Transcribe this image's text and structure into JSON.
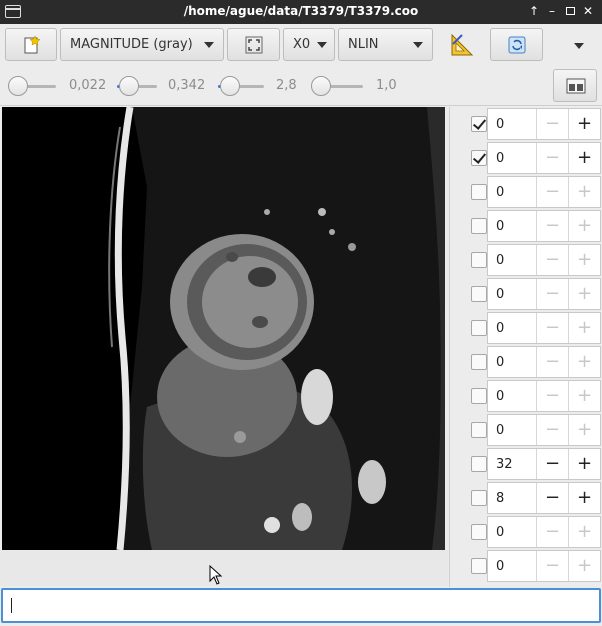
{
  "window": {
    "title": "/home/ague/data/T3379/T3379.coo",
    "controls": [
      "up-arrow-icon",
      "minimize-icon",
      "maximize-icon",
      "close-icon"
    ]
  },
  "toolbar1": {
    "new_icon": "new-document-icon",
    "colormap": "MAGNITUDE (gray)",
    "fit_icon": "fit-to-view-icon",
    "axis": "X0",
    "scale": "NLIN",
    "measure_icon": "measure-triangle-icon",
    "refresh_icon": "refresh-icon",
    "more_icon": "chevron-down-icon"
  },
  "toolbar2": {
    "sliders": [
      {
        "name": "slider-min",
        "value": "0,022",
        "level": 0.0
      },
      {
        "name": "slider-max",
        "value": "0,342",
        "level": 0.15
      },
      {
        "name": "slider-gamma",
        "value": "2,8",
        "level": 0.15
      },
      {
        "name": "slider-alpha",
        "value": "1,0",
        "level": 0.0
      }
    ],
    "layout_icon": "layout-toggle-icon"
  },
  "dimensions": [
    {
      "checked": true,
      "value": "0",
      "minus": false,
      "plus": true
    },
    {
      "checked": true,
      "value": "0",
      "minus": false,
      "plus": true
    },
    {
      "checked": false,
      "value": "0",
      "minus": false,
      "plus": false
    },
    {
      "checked": false,
      "value": "0",
      "minus": false,
      "plus": false
    },
    {
      "checked": false,
      "value": "0",
      "minus": false,
      "plus": false
    },
    {
      "checked": false,
      "value": "0",
      "minus": false,
      "plus": false
    },
    {
      "checked": false,
      "value": "0",
      "minus": false,
      "plus": false
    },
    {
      "checked": false,
      "value": "0",
      "minus": false,
      "plus": false
    },
    {
      "checked": false,
      "value": "0",
      "minus": false,
      "plus": false
    },
    {
      "checked": false,
      "value": "0",
      "minus": false,
      "plus": false
    },
    {
      "checked": false,
      "value": "32",
      "minus": true,
      "plus": true
    },
    {
      "checked": false,
      "value": "8",
      "minus": true,
      "plus": true
    },
    {
      "checked": false,
      "value": "0",
      "minus": false,
      "plus": false
    },
    {
      "checked": false,
      "value": "0",
      "minus": false,
      "plus": false
    }
  ],
  "command": {
    "value": ""
  },
  "colors": {
    "accent": "#4a90d9",
    "titlebar": "#2b2b2b",
    "slider_fill": "#3b7dd8"
  }
}
